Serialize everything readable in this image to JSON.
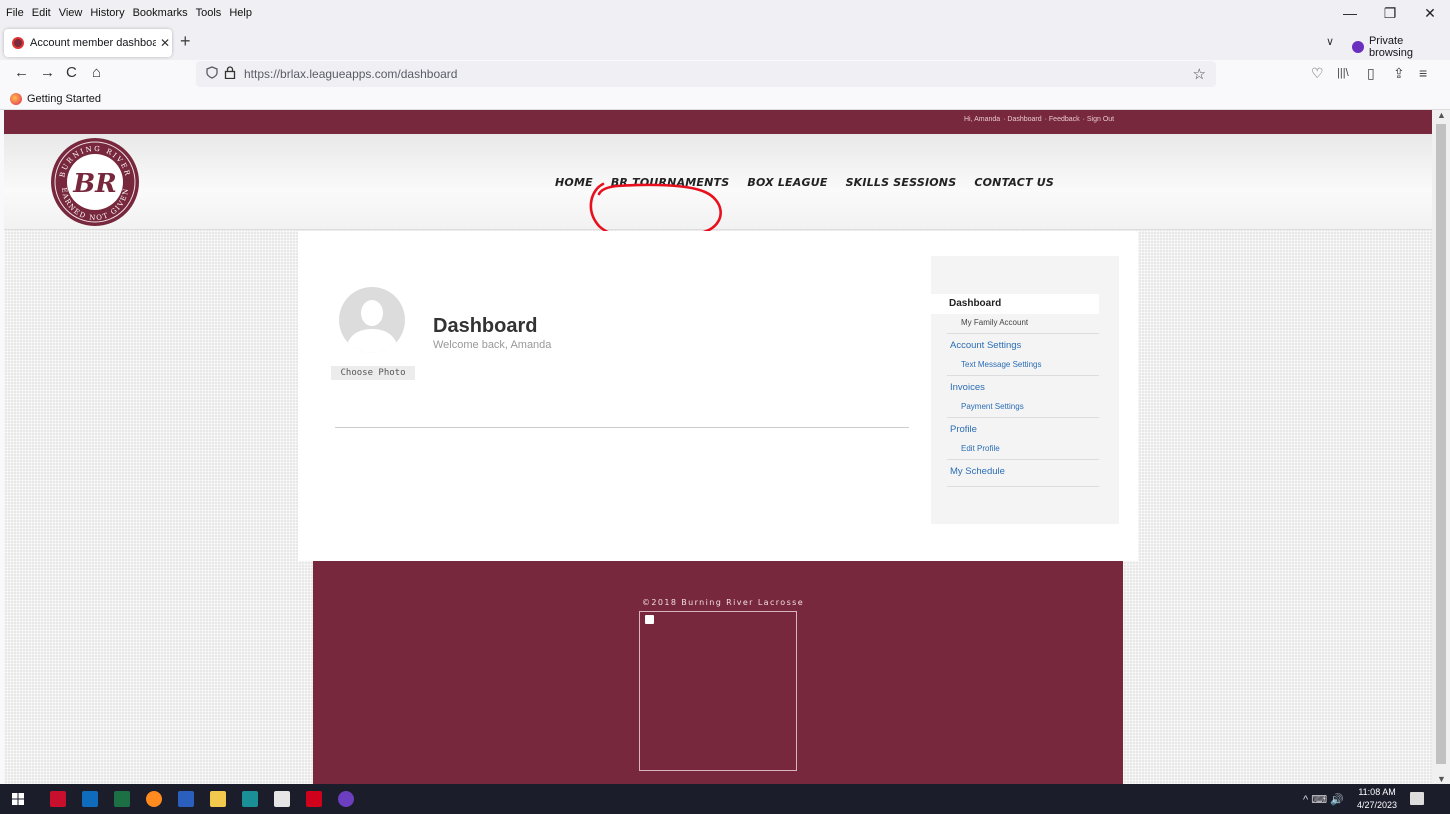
{
  "menubar": {
    "items": [
      "File",
      "Edit",
      "View",
      "History",
      "Bookmarks",
      "Tools",
      "Help"
    ]
  },
  "window_controls": {
    "minimize": "—",
    "restore": "❐",
    "close": "✕"
  },
  "tab": {
    "title": "Account member dashboard : B",
    "close": "✕"
  },
  "new_tab": "+",
  "tab_list": "∨",
  "private_browsing": "Private browsing",
  "nav": {
    "back": "←",
    "forward": "→",
    "reload": "C",
    "home": "⌂"
  },
  "url": {
    "full": "https://brlax.leagueapps.com/dashboard",
    "star": "☆"
  },
  "toolbar_icons": {
    "pocket": "♡",
    "library": "|||\\",
    "sidebar": "▯",
    "extensions": "⇪",
    "menu": "≡"
  },
  "bookmarks": {
    "getting_started": "Getting Started"
  },
  "top_strip": {
    "greeting": "Hi, Amanda",
    "dashboard": "· Dashboard",
    "feedback": "· Feedback",
    "signout": "· Sign Out"
  },
  "logo": {
    "top_text": "BURNING RIVER",
    "bottom_text": "EARNED NOT GIVEN",
    "monogram": "BR"
  },
  "main_nav": [
    "HOME",
    "BR TOURNAMENTS",
    "BOX LEAGUE",
    "SKILLS SESSIONS",
    "CONTACT US"
  ],
  "annotation_color": "#e8101e",
  "profile": {
    "choose_photo": "Choose Photo",
    "title": "Dashboard",
    "subtitle": "Welcome back, Amanda"
  },
  "side_menu": {
    "active": "Dashboard",
    "family": "My Family Account",
    "account_settings": "Account Settings",
    "text_settings": "Text Message Settings",
    "invoices": "Invoices",
    "payment_settings": "Payment Settings",
    "profile": "Profile",
    "edit_profile": "Edit Profile",
    "schedule": "My Schedule"
  },
  "footer": {
    "copyright": "©2018 Burning River Lacrosse"
  },
  "colors": {
    "brand": "#78283c",
    "link": "#2a6db5"
  },
  "taskbar": {
    "time": "11:08 AM",
    "date": "4/27/2023",
    "tray": "^ ⌨ 🔊"
  }
}
